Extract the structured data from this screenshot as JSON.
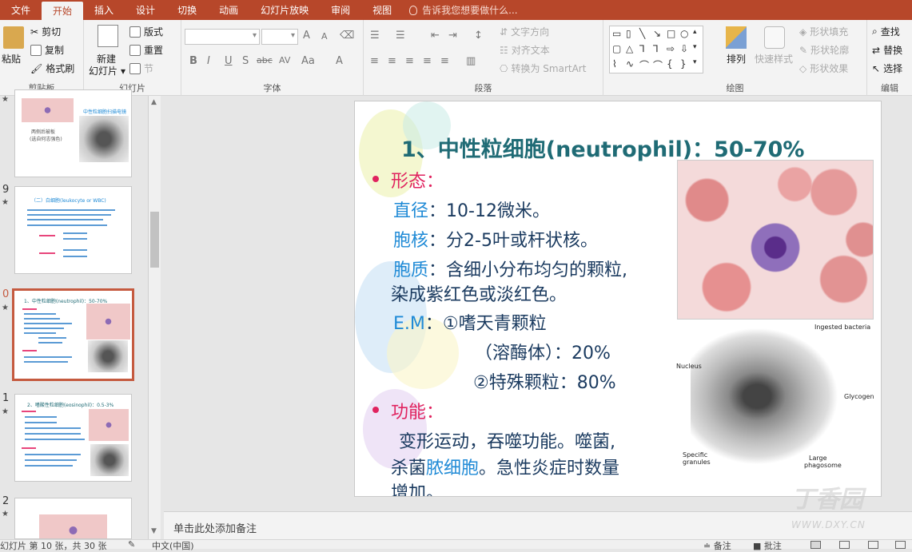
{
  "tabs": [
    {
      "label": "文件",
      "active": false
    },
    {
      "label": "开始",
      "active": true
    },
    {
      "label": "插入",
      "active": false
    },
    {
      "label": "设计",
      "active": false
    },
    {
      "label": "切换",
      "active": false
    },
    {
      "label": "动画",
      "active": false
    },
    {
      "label": "幻灯片放映",
      "active": false
    },
    {
      "label": "审阅",
      "active": false
    },
    {
      "label": "视图",
      "active": false
    }
  ],
  "tell_me": "告诉我您想要做什么...",
  "ribbon": {
    "clipboard": {
      "label": "剪贴板",
      "paste": "粘贴",
      "cut": "剪切",
      "copy": "复制",
      "format_painter": "格式刷"
    },
    "slides": {
      "label": "幻灯片",
      "new_slide": "新建",
      "new_slide2": "幻灯片",
      "layout": "版式",
      "reset": "重置",
      "section": "节"
    },
    "font": {
      "label": "字体",
      "bold": "B",
      "italic": "I",
      "underline": "U",
      "shadow": "S",
      "strike": "abc",
      "spacing": "AV",
      "case": "Aa",
      "color": "A",
      "grow": "A",
      "shrink": "A"
    },
    "paragraph": {
      "label": "段落",
      "text_direction": "文字方向",
      "align_text": "对齐文本",
      "smartart": "转换为 SmartArt"
    },
    "drawing": {
      "label": "绘图",
      "arrange": "排列",
      "quick_styles": "快速样式",
      "shape_fill": "形状填充",
      "shape_outline": "形状轮廓",
      "shape_effects": "形状效果"
    },
    "editing": {
      "label": "编辑",
      "find": "查找",
      "replace": "替换",
      "select": "选择"
    }
  },
  "thumbnails": [
    {
      "num": "",
      "caption_a": "两侧后被板",
      "caption_b": "(选自何志强色)",
      "caption_c": "中性粒细胞扫描电镜"
    },
    {
      "num": "9",
      "title": "（二）白细胞(leukocyte or WBC)"
    },
    {
      "num": "0",
      "title": "1、中性粒细胞(neutrophil)：50-70%"
    },
    {
      "num": "1",
      "title": "2、嗜酸性粒细胞(eosinophil)：0.5-3%"
    },
    {
      "num": "2",
      "title": ""
    }
  ],
  "slide": {
    "title": "1、中性粒细胞(neutrophil)：50-70%",
    "morph_label": "形态",
    "colon": "：",
    "diameter_label": "直径",
    "diameter_value": "：10-12微米。",
    "nucleus_label": "胞核",
    "nucleus_value": "：分2-5叶或杆状核。",
    "cytoplasm_label": "胞质",
    "cytoplasm_value": "：含细小分布均匀的颗粒,",
    "cytoplasm_value2": "染成紫红色或淡红色。",
    "em_label": "E.M",
    "em_value": "：①嗜天青颗粒",
    "em_value2": "（溶酶体）：20%",
    "em_value3": "②特殊颗粒：80%",
    "function_label": "功能",
    "function_line1": "变形运动，吞噬功能。噬菌,",
    "function_line2a": "杀菌",
    "function_line2b": "脓细胞",
    "function_line2c": "。急性炎症时数量",
    "function_line3": "增加。",
    "em_labels": {
      "bacteria": "Ingested bacteria",
      "nucleus": "Nucleus",
      "glycogen": "Glycogen",
      "specific": "Specific",
      "granules": "granules",
      "large": "Large",
      "phagosome": "phagosome"
    }
  },
  "notes_placeholder": "单击此处添加备注",
  "status": {
    "slide_info": "幻灯片 第 10 张，共 30 张",
    "language": "中文(中国)",
    "notes": "备注",
    "comments": "批注"
  },
  "watermark": {
    "logo": "丁香园",
    "url": "WWW.DXY.CN"
  }
}
